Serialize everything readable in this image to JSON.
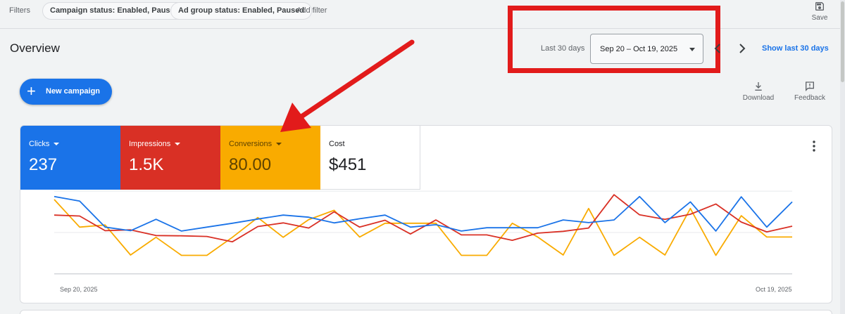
{
  "filter_bar": {
    "label": "Filters",
    "chips": [
      "Campaign status: Enabled, Paused",
      "Ad group status: Enabled, Paused"
    ],
    "add_filter": "Add filter",
    "save_label": "Save"
  },
  "header": {
    "title": "Overview",
    "range_label": "Last 30 days",
    "date_range": "Sep 20 – Oct 19, 2025",
    "show_last": "Show last 30 days"
  },
  "actions": {
    "new_campaign": "New campaign",
    "download": "Download",
    "feedback": "Feedback"
  },
  "metrics": [
    {
      "label": "Clicks",
      "value": "237",
      "color": "#1a73e8"
    },
    {
      "label": "Impressions",
      "value": "1.5K",
      "color": "#d93025"
    },
    {
      "label": "Conversions",
      "value": "80.00",
      "color": "#f9ab00"
    },
    {
      "label": "Cost",
      "value": "$451",
      "color": "#ffffff"
    }
  ],
  "annotation": {
    "highlight_color": "#e21b1b"
  },
  "chart_data": {
    "type": "line",
    "x_start_label": "Sep 20, 2025",
    "x_end_label": "Oct 19, 2025",
    "grid": true,
    "series": [
      {
        "name": "Clicks",
        "color": "#1a73e8",
        "values": [
          12,
          10.5,
          1.8,
          0.6,
          4.4,
          0.5,
          1.8,
          3.1,
          4.5,
          5.8,
          5.1,
          3.2,
          4.6,
          5.8,
          1.8,
          2.6,
          0.5,
          1.6,
          1.6,
          1.6,
          4.2,
          3.3,
          4.2,
          12,
          3.3,
          10.2,
          0.5,
          11.9,
          1.8,
          10.2
        ]
      },
      {
        "name": "Impressions",
        "color": "#d93025",
        "values": [
          5.8,
          5.5,
          0.6,
          0.9,
          -1,
          -1.1,
          -1.3,
          -3.1,
          2,
          3.2,
          1.5,
          6.9,
          1.8,
          4.1,
          -0.5,
          4.2,
          -0.8,
          -0.8,
          -2.6,
          -0.2,
          0.4,
          1.5,
          12.6,
          5.9,
          4.4,
          6.1,
          9.5,
          3.5,
          0.2,
          2.1
        ]
      },
      {
        "name": "Conversions",
        "color": "#f9ab00",
        "values": [
          11,
          1.8,
          2.5,
          -7.5,
          -1.6,
          -7.6,
          -7.6,
          -1.6,
          5,
          -1.6,
          4.3,
          7.4,
          -1.5,
          3.1,
          3.1,
          3.1,
          -7.6,
          -7.6,
          3.1,
          -1.5,
          -7.5,
          8,
          -7.6,
          -1.6,
          -7.5,
          8,
          -7.6,
          5.6,
          -1.5,
          -1.5
        ]
      }
    ]
  }
}
